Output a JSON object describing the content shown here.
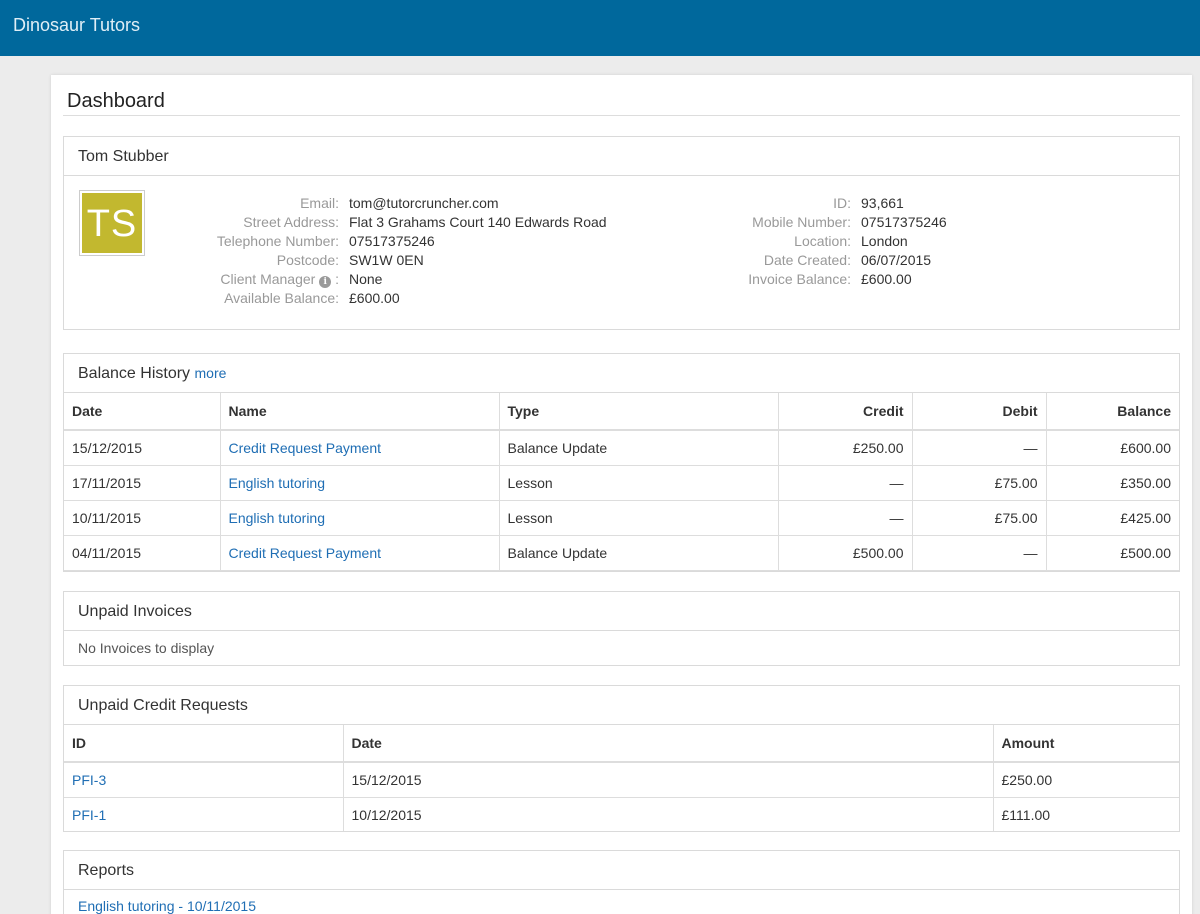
{
  "app": {
    "brand": "Dinosaur Tutors"
  },
  "page": {
    "title": "Dashboard"
  },
  "client": {
    "name": "Tom Stubber",
    "initials": "TS",
    "left_fields": [
      {
        "label": "Email:",
        "value": "tom@tutorcruncher.com"
      },
      {
        "label": "Street Address:",
        "value": "Flat 3 Grahams Court 140 Edwards Road"
      },
      {
        "label": "Telephone Number:",
        "value": "07517375246"
      },
      {
        "label": "Postcode:",
        "value": "SW1W 0EN"
      },
      {
        "label": "Client Manager",
        "value": "None"
      },
      {
        "label": "Available Balance:",
        "value": "£600.00"
      }
    ],
    "right_fields": [
      {
        "label": "ID:",
        "value": "93,661"
      },
      {
        "label": "Mobile Number:",
        "value": "07517375246"
      },
      {
        "label": "Location:",
        "value": "London"
      },
      {
        "label": "Date Created:",
        "value": "06/07/2015"
      },
      {
        "label": "Invoice Balance:",
        "value": "£600.00"
      }
    ],
    "info_icon": "info-circle-icon"
  },
  "balance_history": {
    "title": "Balance History",
    "more_label": "more",
    "columns": [
      "Date",
      "Name",
      "Type",
      "Credit",
      "Debit",
      "Balance"
    ],
    "rows": [
      [
        "15/12/2015",
        "Credit Request Payment",
        "Balance Update",
        "£250.00",
        "—",
        "£600.00"
      ],
      [
        "17/11/2015",
        "English tutoring",
        "Lesson",
        "—",
        "£75.00",
        "£350.00"
      ],
      [
        "10/11/2015",
        "English tutoring",
        "Lesson",
        "—",
        "£75.00",
        "£425.00"
      ],
      [
        "04/11/2015",
        "Credit Request Payment",
        "Balance Update",
        "£500.00",
        "—",
        "£500.00"
      ]
    ]
  },
  "unpaid_invoices": {
    "title": "Unpaid Invoices",
    "empty_message": "No Invoices to display"
  },
  "unpaid_credit_requests": {
    "title": "Unpaid Credit Requests",
    "columns": [
      "ID",
      "Date",
      "Amount"
    ],
    "rows": [
      [
        "PFI-3",
        "15/12/2015",
        "£250.00"
      ],
      [
        "PFI-1",
        "10/12/2015",
        "£111.00"
      ]
    ]
  },
  "reports": {
    "title": "Reports",
    "items": [
      "English tutoring - 10/11/2015"
    ]
  },
  "colors": {
    "navbar": "#00689c",
    "link": "#1f6eb4",
    "avatar": "#c2b82f"
  }
}
